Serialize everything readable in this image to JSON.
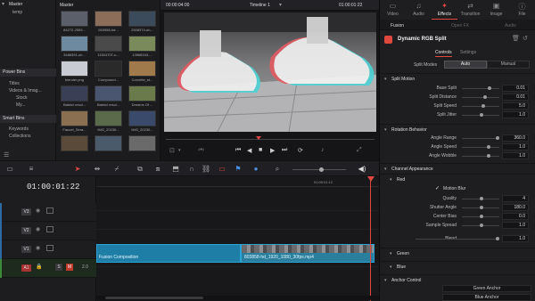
{
  "media_pool": {
    "master_label": "Master",
    "tree_top": [
      "Master",
      "temp"
    ],
    "power_bins_label": "Power Bins",
    "power_bins": [
      "Titles",
      "Videos & Imag...",
      "Stock",
      "My..."
    ],
    "smart_bins_label": "Smart Bins",
    "smart_bins": [
      "Keywords",
      "Collections"
    ],
    "grid_title": "Master",
    "thumbnails": [
      {
        "label": "84272-2559..."
      },
      {
        "label": "053958-hd..."
      },
      {
        "label": "2508374-uh..."
      },
      {
        "label": "3486391-uh..."
      },
      {
        "label": "1150470T-u..."
      },
      {
        "label": "13968343-..."
      },
      {
        "label": "blender.png"
      },
      {
        "label": "Compound..."
      },
      {
        "label": "Corvette_st..."
      },
      {
        "label": "Batnicl resol..."
      },
      {
        "label": "Batnicl resol..."
      },
      {
        "label": "Dreams Of ..."
      },
      {
        "label": "Faucet_Sera..."
      },
      {
        "label": "IMG_20230..."
      },
      {
        "label": "IMG_20230..."
      },
      {
        "label": ""
      },
      {
        "label": ""
      },
      {
        "label": ""
      }
    ]
  },
  "viewer": {
    "timecode_left": "00:00:04:00",
    "timeline_name": "Timeline 1",
    "timecode_right": "01:00:01:22"
  },
  "inspector": {
    "tabs": [
      {
        "label": "Video",
        "active": false
      },
      {
        "label": "Audio",
        "active": false
      },
      {
        "label": "Effects",
        "active": true
      },
      {
        "label": "Transition",
        "active": false
      },
      {
        "label": "Image",
        "active": false
      },
      {
        "label": "File",
        "active": false
      }
    ],
    "subtabs": [
      "Fusion",
      "Open FX",
      "Audio"
    ],
    "effect_title": "Dynamic RGB Split",
    "control_tabs": [
      "Controls",
      "Settings"
    ],
    "split_modes_label": "Split Modes",
    "split_modes": [
      "Auto",
      "Manual"
    ],
    "sections": {
      "split_motion": "Split Motion",
      "rotation_behavior": "Rotation Behavior",
      "channel_appearance": "Channel Appearance",
      "red": "Red",
      "green": "Green",
      "blue": "Blue",
      "anchor_control": "Anchor Control"
    },
    "split_motion": [
      {
        "label": "Base Split",
        "value": "0.01",
        "knob": 0.72
      },
      {
        "label": "Split Distance",
        "value": "0.01",
        "knob": 0.6
      },
      {
        "label": "Split Speed",
        "value": "5.0",
        "knob": 0.55
      },
      {
        "label": "Split Jitter",
        "value": "1.0",
        "knob": 0.5
      }
    ],
    "rotation": [
      {
        "label": "Angle Range",
        "value": "360.0",
        "knob": 0.95
      },
      {
        "label": "Angle Speed",
        "value": "1.0",
        "knob": 0.7
      },
      {
        "label": "Angle Wobble",
        "value": "1.0",
        "knob": 0.7
      }
    ],
    "motion_blur_label": "Motion Blur",
    "red_params": [
      {
        "label": "Quality",
        "value": "4",
        "knob": 0.5
      },
      {
        "label": "Shutter Angle",
        "value": "180.0",
        "knob": 0.5
      },
      {
        "label": "Center Bias",
        "value": "0.0",
        "knob": 0.5
      },
      {
        "label": "Sample Spread",
        "value": "1.0",
        "knob": 0.5
      }
    ],
    "blend_label": "Blend",
    "blend_value": "1.0",
    "anchor_rows": [
      "Green Anchor",
      "Blue Anchor"
    ]
  },
  "timeline": {
    "timecode": "01:00:01:22",
    "ruler_mark": "01:00:01:12",
    "tracks": [
      {
        "label": "V3"
      },
      {
        "label": "V2"
      },
      {
        "label": "V1"
      },
      {
        "label": "A1"
      }
    ],
    "audio_level": "2.0",
    "clip1": "Fusion Composition",
    "clip2": "803858-hd_1920_1080_30fps.mp4"
  },
  "colors": {
    "accent_red": "#e0483f",
    "clip_blue": "#1f7ea6",
    "clip_teal": "#2f8fb0"
  }
}
